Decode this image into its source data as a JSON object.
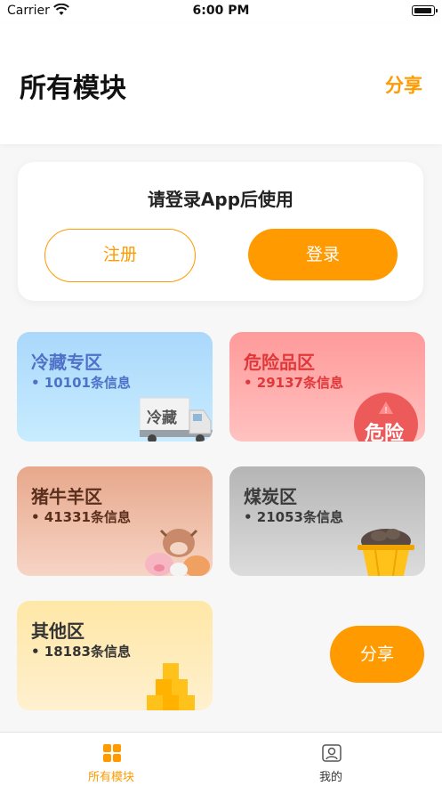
{
  "status_bar": {
    "carrier": "Carrier",
    "time": "6:00 PM"
  },
  "header": {
    "title": "所有模块",
    "share_label": "分享"
  },
  "login_card": {
    "prompt": "请登录App后使用",
    "register_label": "注册",
    "login_label": "登录"
  },
  "modules": [
    {
      "name": "冷藏专区",
      "count": "• 10101条信息",
      "illustration_text": "冷藏",
      "icon": "truck-icon"
    },
    {
      "name": "危险品区",
      "count": "• 29137条信息",
      "illustration_text": "危险",
      "icon": "warning-icon"
    },
    {
      "name": "猪牛羊区",
      "count": "• 41331条信息",
      "icon": "livestock-icon"
    },
    {
      "name": "煤炭区",
      "count": "• 21053条信息",
      "icon": "coal-bucket-icon"
    },
    {
      "name": "其他区",
      "count": "• 18183条信息",
      "icon": "boxes-icon"
    }
  ],
  "floating_share_label": "分享",
  "tabbar": {
    "items": [
      {
        "label": "所有模块",
        "icon": "grid-icon",
        "active": true
      },
      {
        "label": "我的",
        "icon": "profile-icon",
        "active": false
      }
    ]
  },
  "colors": {
    "accent": "#ff9a00",
    "background": "#f7f7f7"
  }
}
